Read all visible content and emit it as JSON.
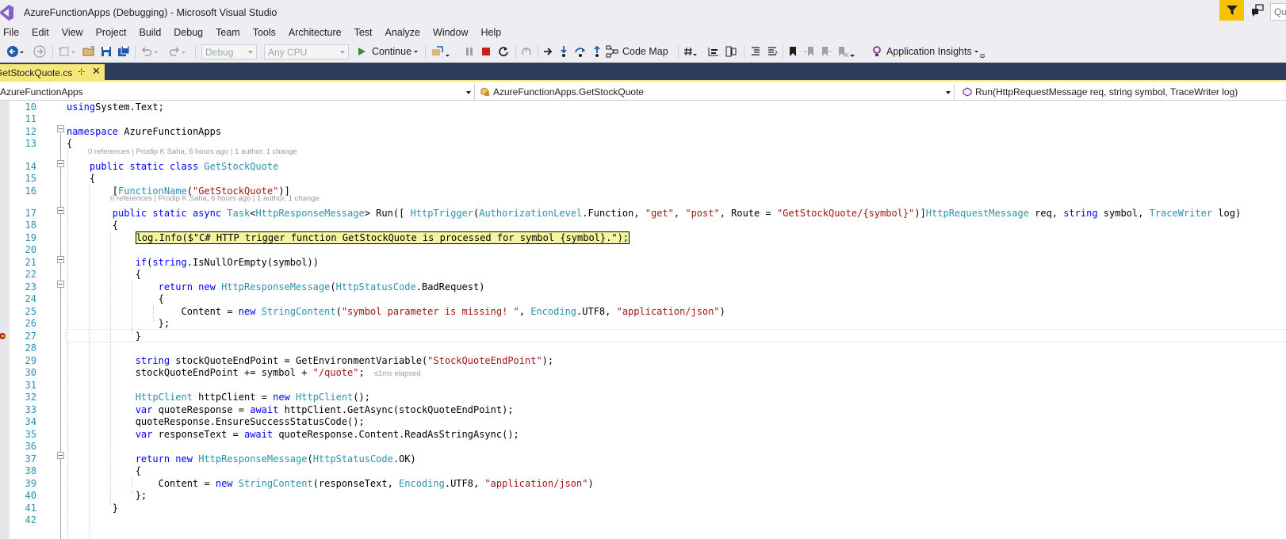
{
  "window": {
    "title": "AzureFunctionApps (Debugging) - Microsoft Visual Studio",
    "quick_launch": "Qu"
  },
  "menu": [
    "File",
    "Edit",
    "View",
    "Project",
    "Build",
    "Debug",
    "Team",
    "Tools",
    "Architecture",
    "Test",
    "Analyze",
    "Window",
    "Help"
  ],
  "toolbar": {
    "config": "Debug",
    "platform": "Any CPU",
    "continue_label": "Continue",
    "code_map_label": "Code Map",
    "app_insights_label": "Application Insights"
  },
  "tabs": [
    {
      "name": "GetStockQuote.cs",
      "active": true
    }
  ],
  "navbar": {
    "project": "AzureFunctionApps",
    "type": "AzureFunctionApps.GetStockQuote",
    "member": "Run(HttpRequestMessage req, string symbol, TraceWriter log)"
  },
  "codelens": {
    "class": "0 references | Prodip K Saha, 6 hours ago | 1 author, 1 change",
    "method": "0 references | Prodip K Saha, 6 hours ago | 1 author, 1 change"
  },
  "perf_tip": "≤1ms elapsed",
  "lines": [
    {
      "n": "10",
      "segs": [
        [
          "kw",
          "using"
        ],
        [
          "",
          "System.Text;"
        ]
      ]
    },
    {
      "n": "11",
      "segs": []
    },
    {
      "n": "12",
      "segs": [
        [
          "kw",
          "namespace"
        ],
        [
          "",
          " AzureFunctionApps"
        ]
      ]
    },
    {
      "n": "13",
      "segs": [
        [
          "",
          "{"
        ]
      ]
    },
    {
      "n": "14",
      "segs": [
        [
          "",
          "    "
        ],
        [
          "kw",
          "public static class "
        ],
        [
          "ty",
          "GetStockQuote"
        ]
      ]
    },
    {
      "n": "15",
      "segs": [
        [
          "",
          "    {"
        ]
      ]
    },
    {
      "n": "16",
      "segs": [
        [
          "",
          "        ["
        ],
        [
          "ty",
          "FunctionName"
        ],
        [
          "",
          "("
        ],
        [
          "st",
          "\"GetStockQuote\""
        ],
        [
          "",
          ")]"
        ]
      ]
    },
    {
      "n": "17",
      "segs": [
        [
          "",
          "        "
        ],
        [
          "kw",
          "public static async "
        ],
        [
          "ty",
          "Task"
        ],
        [
          "",
          "<"
        ],
        [
          "ty",
          "HttpResponseMessage"
        ],
        [
          "",
          "> Run([ "
        ],
        [
          "ty",
          "HttpTrigger"
        ],
        [
          "",
          "("
        ],
        [
          "ty",
          "AuthorizationLevel"
        ],
        [
          "",
          ".Function, "
        ],
        [
          "st",
          "\"get\""
        ],
        [
          "",
          ", "
        ],
        [
          "st",
          "\"post\""
        ],
        [
          "",
          ", Route = "
        ],
        [
          "st",
          "\"GetStockQuote/{symbol}\""
        ],
        [
          "",
          ")]"
        ],
        [
          "ty",
          "HttpRequestMessage"
        ],
        [
          "",
          " req, "
        ],
        [
          "kw",
          "string"
        ],
        [
          "",
          " symbol, "
        ],
        [
          "ty",
          "TraceWriter"
        ],
        [
          "",
          " log)"
        ]
      ]
    },
    {
      "n": "18",
      "segs": [
        [
          "",
          "        {"
        ]
      ]
    },
    {
      "n": "19",
      "segs": [
        [
          "",
          "            "
        ],
        [
          "hl",
          "log.Info($\"C# HTTP trigger function GetStockQuote is processed for symbol {symbol}.\");"
        ]
      ]
    },
    {
      "n": "20",
      "segs": []
    },
    {
      "n": "21",
      "segs": [
        [
          "",
          "            "
        ],
        [
          "kw",
          "if"
        ],
        [
          "",
          "("
        ],
        [
          "kw",
          "string"
        ],
        [
          "",
          ".IsNullOrEmpty(symbol))"
        ]
      ]
    },
    {
      "n": "22",
      "segs": [
        [
          "",
          "            {"
        ]
      ]
    },
    {
      "n": "23",
      "segs": [
        [
          "",
          "                "
        ],
        [
          "kw",
          "return new "
        ],
        [
          "ty",
          "HttpResponseMessage"
        ],
        [
          "",
          "("
        ],
        [
          "ty",
          "HttpStatusCode"
        ],
        [
          "",
          ".BadRequest)"
        ]
      ]
    },
    {
      "n": "24",
      "segs": [
        [
          "",
          "                {"
        ]
      ]
    },
    {
      "n": "25",
      "segs": [
        [
          "",
          "                    Content = "
        ],
        [
          "kw",
          "new "
        ],
        [
          "ty",
          "StringContent"
        ],
        [
          "",
          "("
        ],
        [
          "st",
          "\"symbol parameter is missing! \""
        ],
        [
          "",
          ", "
        ],
        [
          "ty",
          "Encoding"
        ],
        [
          "",
          ".UTF8, "
        ],
        [
          "st",
          "\"application/json\""
        ],
        [
          "",
          ")"
        ]
      ]
    },
    {
      "n": "26",
      "segs": [
        [
          "",
          "                };"
        ]
      ]
    },
    {
      "n": "27",
      "segs": [
        [
          "",
          "            }"
        ]
      ]
    },
    {
      "n": "28",
      "segs": []
    },
    {
      "n": "29",
      "segs": [
        [
          "",
          "            "
        ],
        [
          "kw",
          "string"
        ],
        [
          "",
          " stockQuoteEndPoint = GetEnvironmentVariable("
        ],
        [
          "st",
          "\"StockQuoteEndPoint\""
        ],
        [
          "",
          ");"
        ]
      ]
    },
    {
      "n": "30",
      "segs": [
        [
          "",
          "            stockQuoteEndPoint += symbol + "
        ],
        [
          "st",
          "\"/quote\""
        ],
        [
          "",
          ";"
        ]
      ]
    },
    {
      "n": "31",
      "segs": []
    },
    {
      "n": "32",
      "segs": [
        [
          "",
          "            "
        ],
        [
          "ty",
          "HttpClient"
        ],
        [
          "",
          " httpClient = "
        ],
        [
          "kw",
          "new "
        ],
        [
          "ty",
          "HttpClient"
        ],
        [
          "",
          "();"
        ]
      ]
    },
    {
      "n": "33",
      "segs": [
        [
          "",
          "            "
        ],
        [
          "kw",
          "var"
        ],
        [
          "",
          " quoteResponse = "
        ],
        [
          "kw",
          "await"
        ],
        [
          "",
          " httpClient.GetAsync(stockQuoteEndPoint);"
        ]
      ]
    },
    {
      "n": "34",
      "segs": [
        [
          "",
          "            quoteResponse.EnsureSuccessStatusCode();"
        ]
      ]
    },
    {
      "n": "35",
      "segs": [
        [
          "",
          "            "
        ],
        [
          "kw",
          "var"
        ],
        [
          "",
          " responseText = "
        ],
        [
          "kw",
          "await"
        ],
        [
          "",
          " quoteResponse.Content.ReadAsStringAsync();"
        ]
      ]
    },
    {
      "n": "36",
      "segs": []
    },
    {
      "n": "37",
      "segs": [
        [
          "",
          "            "
        ],
        [
          "kw",
          "return new "
        ],
        [
          "ty",
          "HttpResponseMessage"
        ],
        [
          "",
          "("
        ],
        [
          "ty",
          "HttpStatusCode"
        ],
        [
          "",
          ".OK)"
        ]
      ]
    },
    {
      "n": "38",
      "segs": [
        [
          "",
          "            {"
        ]
      ]
    },
    {
      "n": "39",
      "segs": [
        [
          "",
          "                Content = "
        ],
        [
          "kw",
          "new "
        ],
        [
          "ty",
          "StringContent"
        ],
        [
          "",
          "(responseText, "
        ],
        [
          "ty",
          "Encoding"
        ],
        [
          "",
          ".UTF8, "
        ],
        [
          "st",
          "\"application/json\""
        ],
        [
          "",
          ")"
        ]
      ]
    },
    {
      "n": "40",
      "segs": [
        [
          "",
          "            };"
        ]
      ]
    },
    {
      "n": "41",
      "segs": [
        [
          "",
          "        }"
        ]
      ]
    },
    {
      "n": "42",
      "segs": []
    }
  ]
}
